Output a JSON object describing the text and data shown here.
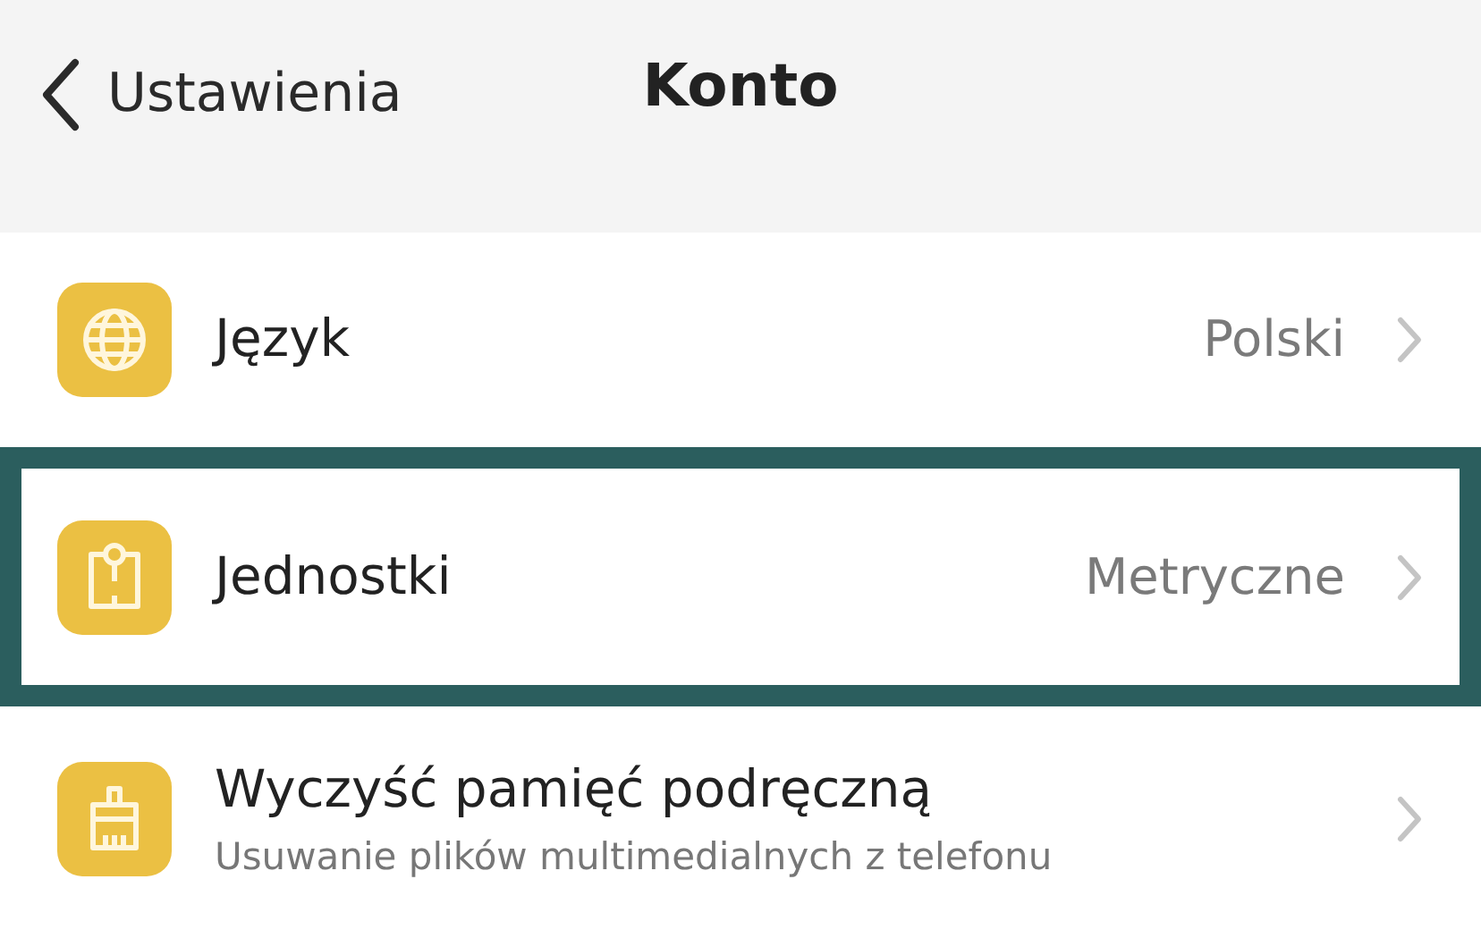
{
  "header": {
    "back_label": "Ustawienia",
    "title": "Konto"
  },
  "items": [
    {
      "label": "Język",
      "value": "Polski",
      "highlighted": false
    },
    {
      "label": "Jednostki",
      "value": "Metryczne",
      "highlighted": true
    },
    {
      "label": "Wyczyść pamięć podręczną",
      "subtitle": "Usuwanie plików multimedialnych z telefonu",
      "highlighted": false
    }
  ]
}
